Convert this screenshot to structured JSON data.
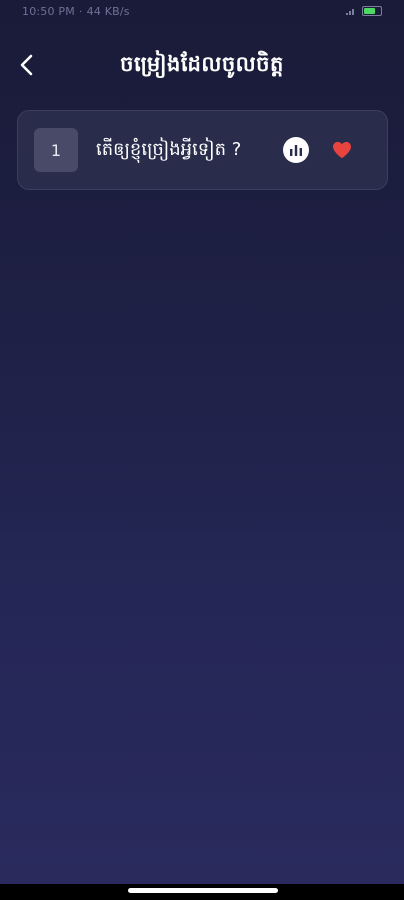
{
  "status_bar": {
    "time": "10:50 PM",
    "network_info": "44 KB/s",
    "battery_color": "#4cd964"
  },
  "header": {
    "title": "ចម្រៀងដែលចូលចិត្ត",
    "back_icon": "chevron-left-icon"
  },
  "songs": [
    {
      "number": "1",
      "title": "តើឲ្យខ្ញុំច្រៀងអ្វីទៀត ?",
      "stats_icon": "bar-chart-icon",
      "favorite_icon": "heart-icon",
      "favorite_color": "#e8433e"
    }
  ],
  "theme": {
    "background_top": "#1a1b38",
    "background_bottom": "#2a2a5e",
    "card_background": "#2a2c4b"
  }
}
